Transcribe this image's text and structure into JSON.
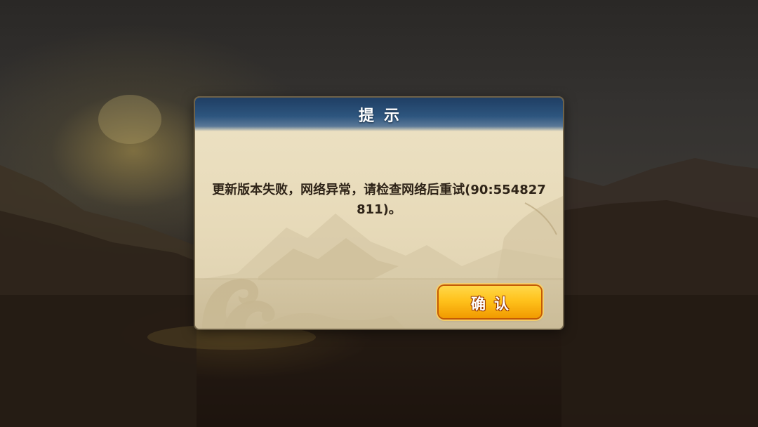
{
  "dialog": {
    "title": "提示",
    "message": "更新版本失败，网络异常，请检查网络后重试(90:554827811)。",
    "confirm_label": "确认"
  },
  "colors": {
    "header_blue": "#2d557e",
    "button_orange": "#ffc21c",
    "parchment": "#ede2c4"
  }
}
